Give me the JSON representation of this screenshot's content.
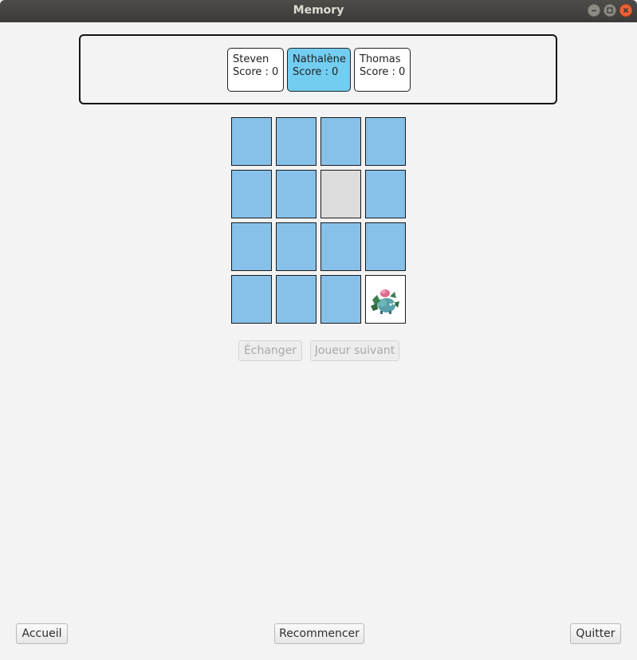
{
  "window": {
    "title": "Memory"
  },
  "players": [
    {
      "name": "Steven",
      "score": "Score : 0",
      "active": false
    },
    {
      "name": "Nathalène",
      "score": "Score : 0",
      "active": true
    },
    {
      "name": "Thomas",
      "score": "Score : 0",
      "active": false
    }
  ],
  "board": {
    "rows": 4,
    "cols": 4,
    "cards": [
      "hidden",
      "hidden",
      "hidden",
      "hidden",
      "hidden",
      "hidden",
      "empty",
      "hidden",
      "hidden",
      "hidden",
      "hidden",
      "hidden",
      "hidden",
      "hidden",
      "hidden",
      "revealed-ivysaur"
    ]
  },
  "actions": {
    "swap": "Échanger",
    "next_player": "Joueur suivant"
  },
  "footer": {
    "home": "Accueil",
    "restart": "Recommencer",
    "quit": "Quitter"
  },
  "colors": {
    "card_back": "#87c1ea",
    "active_player": "#72cdf0",
    "empty_card": "#dcdcdc"
  }
}
